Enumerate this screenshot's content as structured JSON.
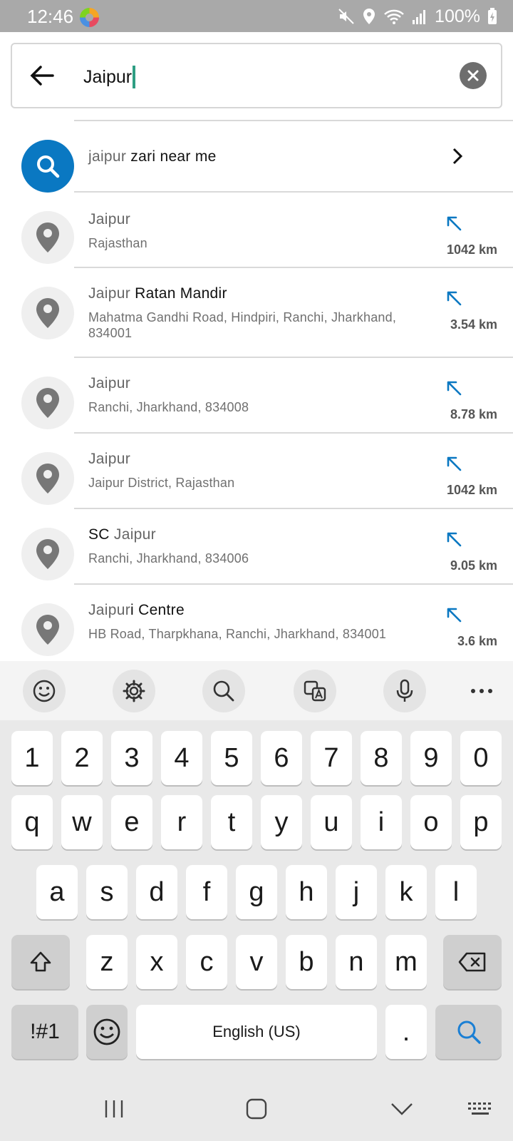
{
  "status_bar": {
    "time": "12:46",
    "battery": "100%"
  },
  "search": {
    "query": "Jaipur"
  },
  "suggestion": {
    "dim": "jaipur",
    "rest": " zari near me"
  },
  "results": [
    {
      "title_dim": "Jaipur",
      "title_rest": "",
      "title_pre": "",
      "subtitle": "Rajasthan",
      "distance": "1042 km"
    },
    {
      "title_dim": "Jaipur",
      "title_rest": " Ratan Mandir",
      "title_pre": "",
      "subtitle": "Mahatma Gandhi Road, Hindpiri, Ranchi, Jharkhand, 834001",
      "distance": "3.54 km"
    },
    {
      "title_dim": "Jaipur",
      "title_rest": "",
      "title_pre": "",
      "subtitle": "Ranchi, Jharkhand, 834008",
      "distance": "8.78 km"
    },
    {
      "title_dim": "Jaipur",
      "title_rest": "",
      "title_pre": "",
      "subtitle": "Jaipur District, Rajasthan",
      "distance": "1042 km"
    },
    {
      "title_dim": "Jaipur",
      "title_rest": "",
      "title_pre": "SC ",
      "subtitle": "Ranchi, Jharkhand, 834006",
      "distance": "9.05 km"
    },
    {
      "title_dim": "Jaipur",
      "title_rest": "i Centre",
      "title_pre": "",
      "subtitle": "HB Road, Tharpkhana, Ranchi, Jharkhand, 834001",
      "distance": "3.6 km"
    }
  ],
  "keyboard": {
    "numbers": [
      "1",
      "2",
      "3",
      "4",
      "5",
      "6",
      "7",
      "8",
      "9",
      "0"
    ],
    "row1": [
      "q",
      "w",
      "e",
      "r",
      "t",
      "y",
      "u",
      "i",
      "o",
      "p"
    ],
    "row2": [
      "a",
      "s",
      "d",
      "f",
      "g",
      "h",
      "j",
      "k",
      "l"
    ],
    "row3": [
      "z",
      "x",
      "c",
      "v",
      "b",
      "n",
      "m"
    ],
    "symbols_label": "!#1",
    "space_label": "English (US)",
    "period_label": "."
  },
  "colors": {
    "accent_blue": "#0a78c2",
    "caret_green": "#2e9e83",
    "status_bar": "#a9a9a9"
  },
  "icons": {
    "back": "arrow-left-icon",
    "clear": "close-circle-icon",
    "search": "search-icon",
    "place": "map-pin-icon",
    "fill_query": "arrow-up-left-icon"
  }
}
